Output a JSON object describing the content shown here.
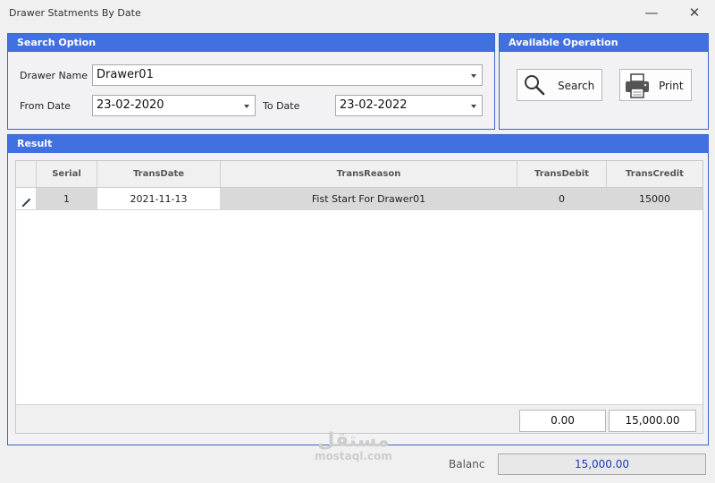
{
  "window": {
    "title": "Drawer Statments By Date",
    "minimize_glyph": "—",
    "close_glyph": "✕"
  },
  "search_option": {
    "title": "Search Option",
    "drawer_name_label": "Drawer Name",
    "drawer_name_value": "Drawer01",
    "from_date_label": "From Date",
    "from_date_value": "23-02-2020",
    "to_date_label": "To Date",
    "to_date_value": "23-02-2022"
  },
  "available_operation": {
    "title": "Available Operation",
    "search_label": "Search",
    "print_label": "Print"
  },
  "result": {
    "title": "Result",
    "columns": [
      "Serial",
      "TransDate",
      "TransReason",
      "TransDebit",
      "TransCredit"
    ],
    "rows": [
      {
        "serial": "1",
        "trans_date": "2021-11-13",
        "trans_reason": "Fist Start For  Drawer01",
        "trans_debit": "0",
        "trans_credit": "15000"
      }
    ],
    "total_debit": "0.00",
    "total_credit": "15,000.00"
  },
  "balance": {
    "label": "Balanc",
    "value": "15,000.00"
  },
  "watermark": {
    "arabic": "مستقل",
    "latin": "mostaql.com"
  },
  "colors": {
    "group_header": "#4170e0",
    "group_border": "#3f63c8",
    "balance_text": "#1a3bb5"
  },
  "icons": {
    "search": "magnifier-icon",
    "print": "printer-icon",
    "row_edit": "pencil-icon",
    "dropdown": "chevron-down-icon"
  }
}
